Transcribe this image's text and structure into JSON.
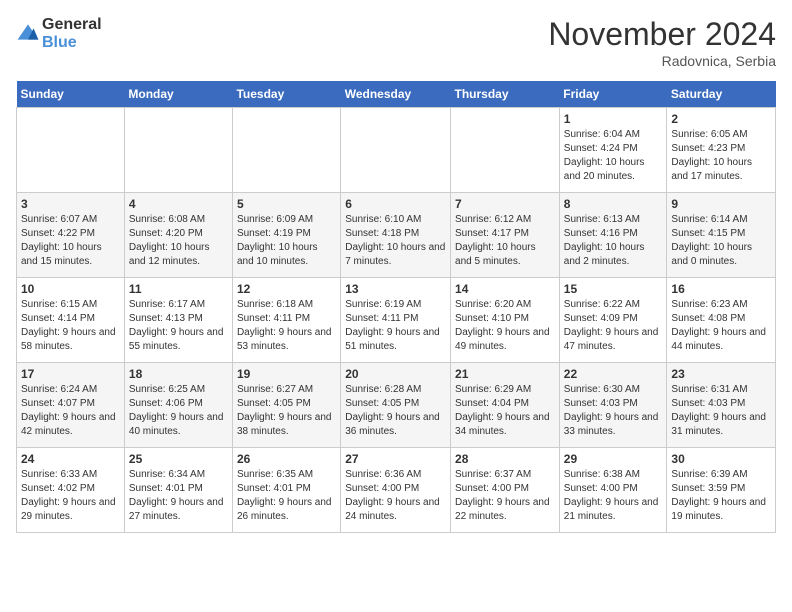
{
  "header": {
    "logo_line1": "General",
    "logo_line2": "Blue",
    "month_title": "November 2024",
    "location": "Radovnica, Serbia"
  },
  "days_of_week": [
    "Sunday",
    "Monday",
    "Tuesday",
    "Wednesday",
    "Thursday",
    "Friday",
    "Saturday"
  ],
  "weeks": [
    [
      {
        "day": "",
        "content": ""
      },
      {
        "day": "",
        "content": ""
      },
      {
        "day": "",
        "content": ""
      },
      {
        "day": "",
        "content": ""
      },
      {
        "day": "",
        "content": ""
      },
      {
        "day": "1",
        "content": "Sunrise: 6:04 AM\nSunset: 4:24 PM\nDaylight: 10 hours and 20 minutes."
      },
      {
        "day": "2",
        "content": "Sunrise: 6:05 AM\nSunset: 4:23 PM\nDaylight: 10 hours and 17 minutes."
      }
    ],
    [
      {
        "day": "3",
        "content": "Sunrise: 6:07 AM\nSunset: 4:22 PM\nDaylight: 10 hours and 15 minutes."
      },
      {
        "day": "4",
        "content": "Sunrise: 6:08 AM\nSunset: 4:20 PM\nDaylight: 10 hours and 12 minutes."
      },
      {
        "day": "5",
        "content": "Sunrise: 6:09 AM\nSunset: 4:19 PM\nDaylight: 10 hours and 10 minutes."
      },
      {
        "day": "6",
        "content": "Sunrise: 6:10 AM\nSunset: 4:18 PM\nDaylight: 10 hours and 7 minutes."
      },
      {
        "day": "7",
        "content": "Sunrise: 6:12 AM\nSunset: 4:17 PM\nDaylight: 10 hours and 5 minutes."
      },
      {
        "day": "8",
        "content": "Sunrise: 6:13 AM\nSunset: 4:16 PM\nDaylight: 10 hours and 2 minutes."
      },
      {
        "day": "9",
        "content": "Sunrise: 6:14 AM\nSunset: 4:15 PM\nDaylight: 10 hours and 0 minutes."
      }
    ],
    [
      {
        "day": "10",
        "content": "Sunrise: 6:15 AM\nSunset: 4:14 PM\nDaylight: 9 hours and 58 minutes."
      },
      {
        "day": "11",
        "content": "Sunrise: 6:17 AM\nSunset: 4:13 PM\nDaylight: 9 hours and 55 minutes."
      },
      {
        "day": "12",
        "content": "Sunrise: 6:18 AM\nSunset: 4:11 PM\nDaylight: 9 hours and 53 minutes."
      },
      {
        "day": "13",
        "content": "Sunrise: 6:19 AM\nSunset: 4:11 PM\nDaylight: 9 hours and 51 minutes."
      },
      {
        "day": "14",
        "content": "Sunrise: 6:20 AM\nSunset: 4:10 PM\nDaylight: 9 hours and 49 minutes."
      },
      {
        "day": "15",
        "content": "Sunrise: 6:22 AM\nSunset: 4:09 PM\nDaylight: 9 hours and 47 minutes."
      },
      {
        "day": "16",
        "content": "Sunrise: 6:23 AM\nSunset: 4:08 PM\nDaylight: 9 hours and 44 minutes."
      }
    ],
    [
      {
        "day": "17",
        "content": "Sunrise: 6:24 AM\nSunset: 4:07 PM\nDaylight: 9 hours and 42 minutes."
      },
      {
        "day": "18",
        "content": "Sunrise: 6:25 AM\nSunset: 4:06 PM\nDaylight: 9 hours and 40 minutes."
      },
      {
        "day": "19",
        "content": "Sunrise: 6:27 AM\nSunset: 4:05 PM\nDaylight: 9 hours and 38 minutes."
      },
      {
        "day": "20",
        "content": "Sunrise: 6:28 AM\nSunset: 4:05 PM\nDaylight: 9 hours and 36 minutes."
      },
      {
        "day": "21",
        "content": "Sunrise: 6:29 AM\nSunset: 4:04 PM\nDaylight: 9 hours and 34 minutes."
      },
      {
        "day": "22",
        "content": "Sunrise: 6:30 AM\nSunset: 4:03 PM\nDaylight: 9 hours and 33 minutes."
      },
      {
        "day": "23",
        "content": "Sunrise: 6:31 AM\nSunset: 4:03 PM\nDaylight: 9 hours and 31 minutes."
      }
    ],
    [
      {
        "day": "24",
        "content": "Sunrise: 6:33 AM\nSunset: 4:02 PM\nDaylight: 9 hours and 29 minutes."
      },
      {
        "day": "25",
        "content": "Sunrise: 6:34 AM\nSunset: 4:01 PM\nDaylight: 9 hours and 27 minutes."
      },
      {
        "day": "26",
        "content": "Sunrise: 6:35 AM\nSunset: 4:01 PM\nDaylight: 9 hours and 26 minutes."
      },
      {
        "day": "27",
        "content": "Sunrise: 6:36 AM\nSunset: 4:00 PM\nDaylight: 9 hours and 24 minutes."
      },
      {
        "day": "28",
        "content": "Sunrise: 6:37 AM\nSunset: 4:00 PM\nDaylight: 9 hours and 22 minutes."
      },
      {
        "day": "29",
        "content": "Sunrise: 6:38 AM\nSunset: 4:00 PM\nDaylight: 9 hours and 21 minutes."
      },
      {
        "day": "30",
        "content": "Sunrise: 6:39 AM\nSunset: 3:59 PM\nDaylight: 9 hours and 19 minutes."
      }
    ]
  ]
}
